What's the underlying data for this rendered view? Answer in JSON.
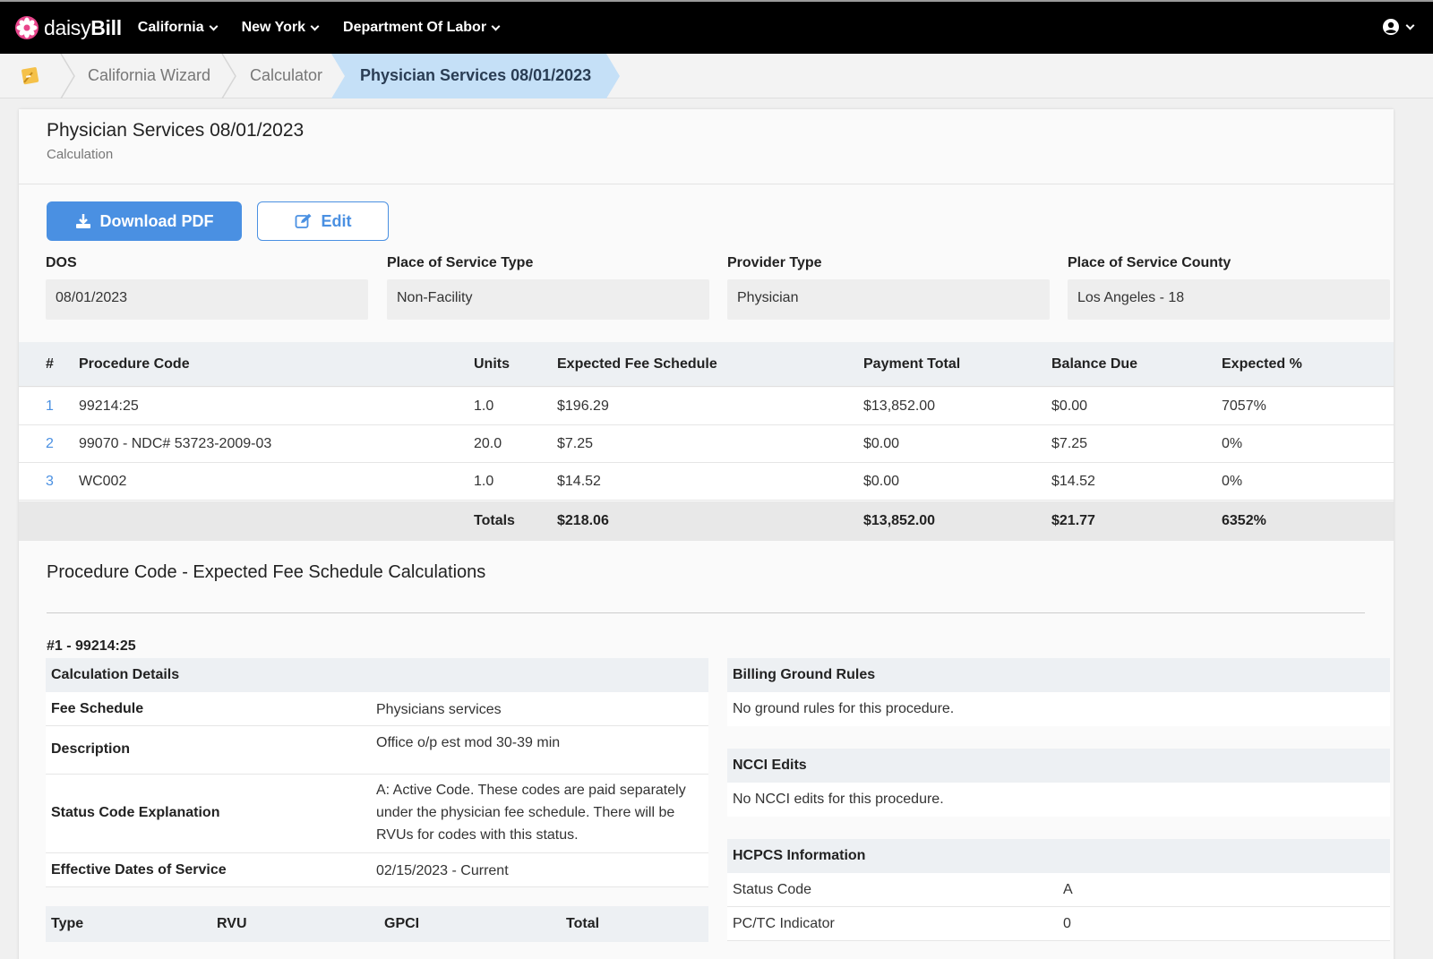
{
  "nav": {
    "brand_light": "daisy",
    "brand_bold": "Bill",
    "menus": [
      "California",
      "New York",
      "Department Of Labor"
    ]
  },
  "breadcrumb": [
    "California Wizard",
    "Calculator",
    "Physician Services 08/01/2023"
  ],
  "header": {
    "title": "Physician Services 08/01/2023",
    "subtitle": "Calculation"
  },
  "actions": {
    "download_label": "Download PDF",
    "edit_label": "Edit"
  },
  "fields": [
    {
      "label": "DOS",
      "value": "08/01/2023"
    },
    {
      "label": "Place of Service Type",
      "value": "Non-Facility"
    },
    {
      "label": "Provider Type",
      "value": "Physician"
    },
    {
      "label": "Place of Service County",
      "value": "Los Angeles - 18"
    }
  ],
  "table": {
    "headers": [
      "#",
      "Procedure Code",
      "Units",
      "Expected Fee Schedule",
      "Payment Total",
      "Balance Due",
      "Expected %"
    ],
    "rows": [
      [
        "1",
        "99214:25",
        "1.0",
        "$196.29",
        "$13,852.00",
        "$0.00",
        "7057%"
      ],
      [
        "2",
        "99070 - NDC# 53723-2009-03",
        "20.0",
        "$7.25",
        "$0.00",
        "$7.25",
        "0%"
      ],
      [
        "3",
        "WC002",
        "1.0",
        "$14.52",
        "$0.00",
        "$14.52",
        "0%"
      ]
    ],
    "totals": {
      "label": "Totals",
      "expected": "$218.06",
      "payment": "$13,852.00",
      "balance": "$21.77",
      "percent": "6352%"
    }
  },
  "calc_section": {
    "title": "Procedure Code - Expected Fee Schedule Calculations",
    "proc_label": "#1 - 99214:25",
    "details_heading": "Calculation Details",
    "details": [
      {
        "key": "Fee Schedule",
        "value": "Physicians services"
      },
      {
        "key": "Description",
        "value": "Office o/p est mod 30-39 min"
      },
      {
        "key": "Status Code Explanation",
        "value": "A: Active Code. These codes are paid separately under the physician fee schedule. There will be RVUs for codes with this status."
      },
      {
        "key": "Effective Dates of Service",
        "value": "02/15/2023 - Current"
      }
    ],
    "rvu_headers": [
      "Type",
      "RVU",
      "GPCI",
      "Total"
    ],
    "billing_heading": "Billing Ground Rules",
    "billing_text": "No ground rules for this procedure.",
    "ncci_heading": "NCCI Edits",
    "ncci_text": "No NCCI edits for this procedure.",
    "hcpcs_heading": "HCPCS Information",
    "hcpcs": [
      {
        "key": "Status Code",
        "value": "A"
      },
      {
        "key": "PC/TC Indicator",
        "value": "0"
      }
    ]
  },
  "colors": {
    "accent": "#4a90e2",
    "active_crumb": "#c5e0f7",
    "nav_bg": "#000000"
  }
}
